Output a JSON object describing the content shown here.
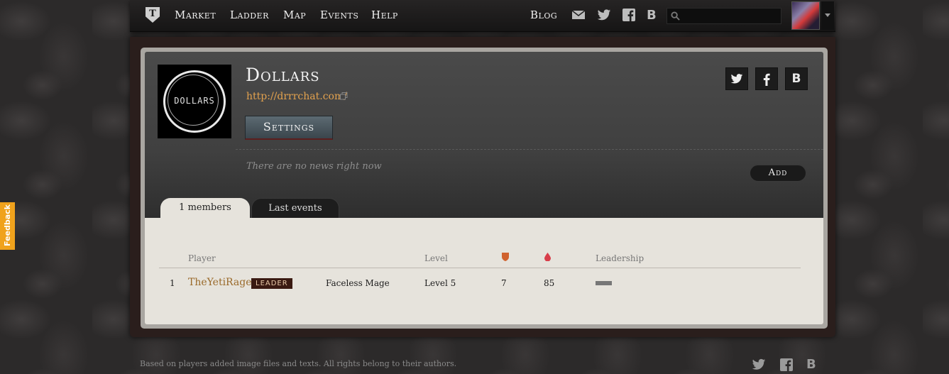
{
  "nav": {
    "logo_letter": "T",
    "links": [
      "Market",
      "Ladder",
      "Map",
      "Events",
      "Help"
    ],
    "blog_label": "Blog",
    "search": {
      "value": "",
      "placeholder": ""
    },
    "icons": [
      "mail-icon",
      "twitter-icon",
      "facebook-icon",
      "b-icon",
      "search-icon"
    ]
  },
  "guild": {
    "logo_text": "DOLLARS",
    "name": "Dollars",
    "url": "http://drrrchat.com/",
    "settings_label": "Settings",
    "social": [
      "twitter-icon",
      "facebook-icon",
      "b-icon"
    ],
    "social_b_letter": "B",
    "no_news": "There are no news right now",
    "add_label": "Add"
  },
  "tabs": [
    {
      "label": "1 members",
      "active": true
    },
    {
      "label": "Last events",
      "active": false
    }
  ],
  "table": {
    "headers": {
      "player": "Player",
      "level": "Level",
      "leadership": "Leadership"
    },
    "header_icons": [
      "shield-icon",
      "drop-icon"
    ],
    "rows": [
      {
        "rank": "1",
        "player": "TheYetiRage",
        "badge": "LEADER",
        "class": "Faceless Mage",
        "level": "Level 5",
        "stat1": "7",
        "stat2": "85"
      }
    ]
  },
  "feedback_label": "Feedback",
  "footer": {
    "text": "Based on players added image files and texts. All rights belong to their authors.",
    "b_letter": "B"
  },
  "colors": {
    "accent_link": "#e3a24e",
    "player_link": "#9a6a2a",
    "feedback": "#f0a21c",
    "leader_badge_bg": "#3a1a12"
  }
}
